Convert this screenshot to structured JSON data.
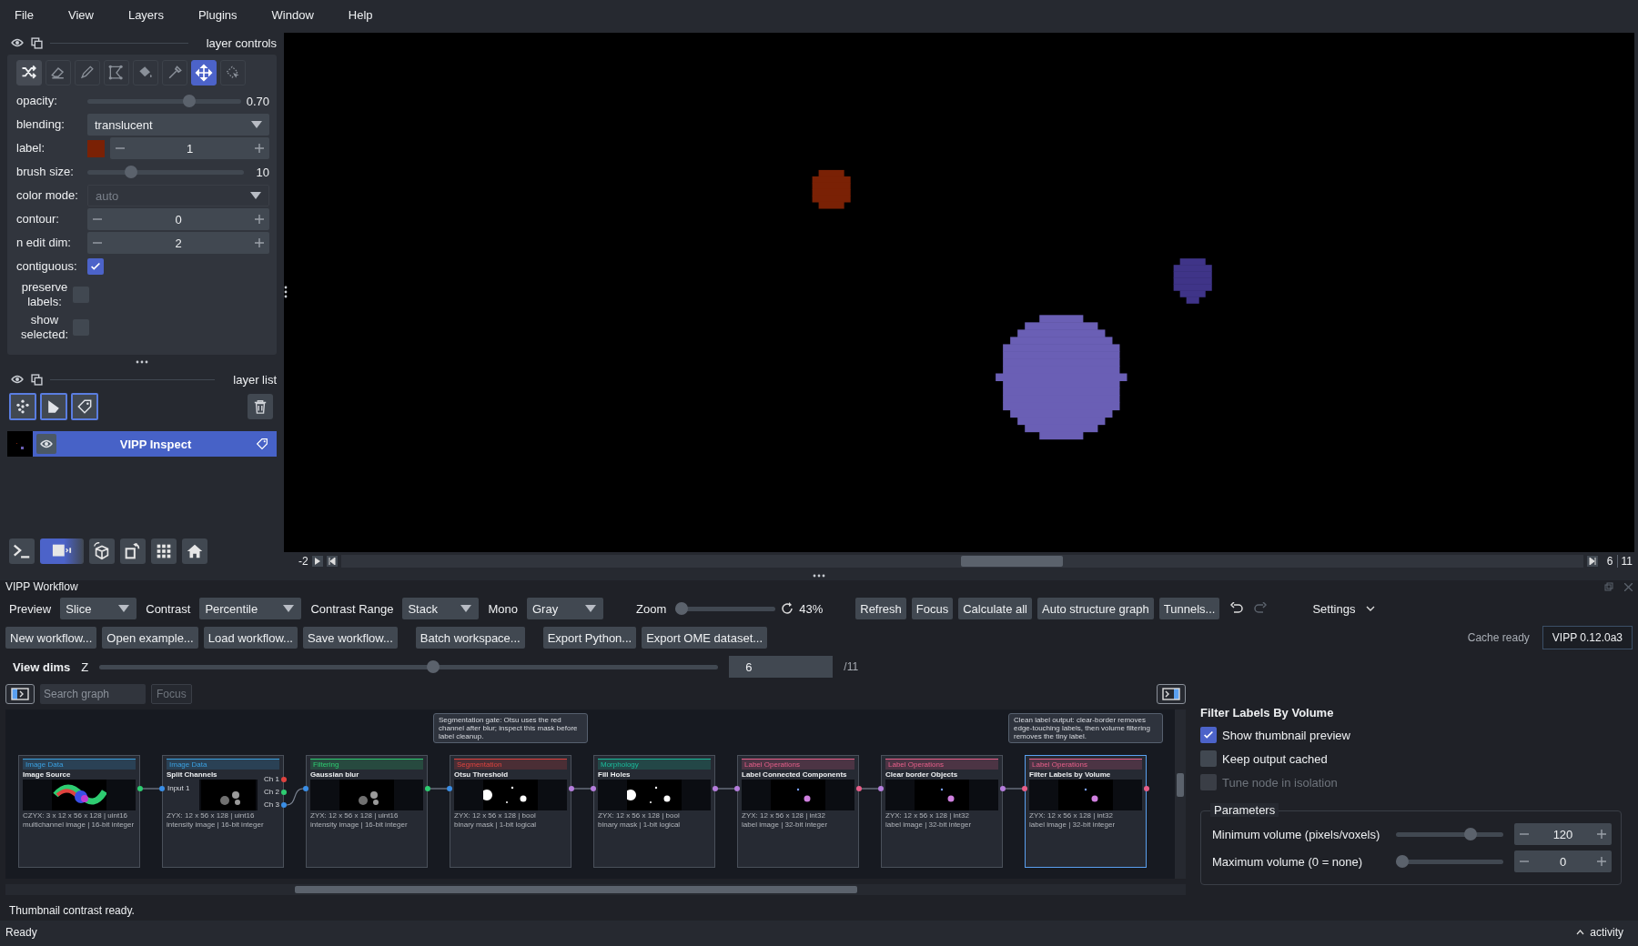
{
  "menu": [
    "File",
    "View",
    "Layers",
    "Plugins",
    "Window",
    "Help"
  ],
  "layer_controls": {
    "title": "layer controls",
    "tools": [
      {
        "kind": "shuffle",
        "selected": false
      },
      {
        "kind": "eraser",
        "selected": false
      },
      {
        "kind": "pencil",
        "selected": false
      },
      {
        "kind": "polygon",
        "selected": false
      },
      {
        "kind": "fill",
        "selected": false
      },
      {
        "kind": "picker",
        "selected": false
      },
      {
        "kind": "move",
        "selected": true
      },
      {
        "kind": "select",
        "selected": false
      }
    ],
    "rows": [
      {
        "kind": "slider",
        "label": "opacity:",
        "level": 0.68,
        "reading": "0.70"
      },
      {
        "kind": "dropdown",
        "label": "blending:",
        "value": "translucent",
        "disabled": false
      },
      {
        "kind": "label_spin",
        "label": "label:",
        "color": "#7a2105",
        "value": "1"
      },
      {
        "kind": "slider",
        "label": "brush size:",
        "level": 0.26,
        "reading": "10"
      },
      {
        "kind": "dropdown",
        "label": "color mode:",
        "value": "auto",
        "disabled": true
      },
      {
        "kind": "spin",
        "label": "contour:",
        "value": "0"
      },
      {
        "kind": "spin",
        "label": "n edit dim:",
        "value": "2"
      },
      {
        "kind": "checkbox",
        "label": "contiguous:",
        "checked": true
      },
      {
        "kind": "checkbox",
        "label": "preserve labels:",
        "checked": false
      },
      {
        "kind": "checkbox",
        "label": "show selected:",
        "checked": false
      }
    ]
  },
  "layer_list": {
    "title": "layer list",
    "add_buttons": [
      {
        "kind": "points"
      },
      {
        "kind": "shapes"
      },
      {
        "kind": "labels"
      }
    ],
    "layers": [
      {
        "name": "VIPP Inspect",
        "selected": true,
        "visible": true
      }
    ]
  },
  "viewer_buttons": [
    {
      "kind": "console",
      "selected": false
    },
    {
      "kind": "ndisplay",
      "selected": true
    },
    {
      "kind": "roll",
      "selected": false
    },
    {
      "kind": "transpose",
      "selected": false
    },
    {
      "kind": "grid",
      "selected": false
    },
    {
      "kind": "home",
      "selected": false
    }
  ],
  "dims": {
    "fps": "-2",
    "level": 0.54,
    "current": "6",
    "total": "11"
  },
  "workflow": {
    "title": "VIPP Workflow",
    "selectors": [
      {
        "label": "Preview",
        "value": "Slice"
      },
      {
        "label": "Contrast",
        "value": "Percentile"
      },
      {
        "label": "Contrast Range",
        "value": "Stack"
      },
      {
        "label": "Mono",
        "value": "Gray"
      }
    ],
    "zoom": {
      "label": "Zoom",
      "level": 0.0,
      "reading": "43%"
    },
    "actions": [
      {
        "label": "Refresh"
      },
      {
        "label": "Focus"
      },
      {
        "label": "Calculate all"
      },
      {
        "label": "Auto structure graph"
      },
      {
        "label": "Tunnels..."
      }
    ],
    "undo_enabled": true,
    "redo_enabled": false,
    "settings": "Settings",
    "file_buttons": [
      {
        "label": "New workflow..."
      },
      {
        "label": "Open example..."
      },
      {
        "label": "Load workflow..."
      },
      {
        "label": "Save workflow..."
      },
      {
        "label": "Batch workspace..."
      },
      {
        "label": "Export Python..."
      },
      {
        "label": "Export OME dataset..."
      }
    ],
    "cache_status": "Cache ready",
    "version": "VIPP 0.12.0a3",
    "view_dims": {
      "title": "View dims",
      "axis": "Z",
      "level": 0.54,
      "value": "6",
      "total": "/11"
    },
    "search": {
      "placeholder": "Search graph",
      "focus": "Focus",
      "sidebar_open": true,
      "inspector_open": true
    },
    "nodes": [
      {
        "category": "Image Data",
        "color": "#3aa0e0",
        "title": "Image Source",
        "meta": "CZYX: 3 x 12 x 56 x 128 | uint16",
        "type": "multichannel image | 16-bit integer",
        "outputs": [
          {
            "color": "#2ecc71"
          }
        ],
        "selected": false
      },
      {
        "category": "Image Data",
        "color": "#3aa0e0",
        "title": "Split Channels",
        "meta": "ZYX: 12 x 56 x 128 | uint16",
        "type": "intensity image | 16-bit integer",
        "inputs": [
          {
            "label": "Input 1",
            "color": "#3a8ee6"
          }
        ],
        "outputs": [
          {
            "label": "Ch 1",
            "color": "#e0433f"
          },
          {
            "label": "Ch 2",
            "color": "#2ecc71"
          },
          {
            "label": "Ch 3",
            "color": "#3a8ee6"
          }
        ],
        "selected": false
      },
      {
        "category": "Filtering",
        "color": "#2ecc71",
        "title": "Gaussian blur",
        "meta": "ZYX: 12 x 56 x 128 | uint16",
        "type": "intensity image | 16-bit integer",
        "inputs": [
          {
            "color": "#3a8ee6"
          }
        ],
        "outputs": [
          {
            "color": "#2ecc71"
          }
        ],
        "selected": false
      },
      {
        "category": "Segmentation",
        "color": "#e0433f",
        "title": "Otsu Threshold",
        "meta": "ZYX: 12 x 56 x 128 | bool",
        "type": "binary mask | 1-bit logical",
        "note": "Segmentation gate: Otsu uses the red channel after blur; inspect this mask before label cleanup.",
        "inputs": [
          {
            "color": "#3a8ee6"
          }
        ],
        "outputs": [
          {
            "color": "#b57edc"
          }
        ],
        "selected": false
      },
      {
        "category": "Morphology",
        "color": "#1abc9c",
        "title": "Fill Holes",
        "meta": "ZYX: 12 x 56 x 128 | bool",
        "type": "binary mask | 1-bit logical",
        "inputs": [
          {
            "color": "#b57edc"
          }
        ],
        "outputs": [
          {
            "color": "#b57edc"
          }
        ],
        "selected": false
      },
      {
        "category": "Label Operations",
        "color": "#e85f8a",
        "title": "Label Connected Components",
        "meta": "ZYX: 12 x 56 x 128 | int32",
        "type": "label image | 32-bit integer",
        "inputs": [
          {
            "color": "#b57edc"
          }
        ],
        "outputs": [
          {
            "color": "#e85f8a"
          }
        ],
        "selected": false
      },
      {
        "category": "Label Operations",
        "color": "#e85f8a",
        "title": "Clear border Objects",
        "meta": "ZYX: 12 x 56 x 128 | int32",
        "type": "label image | 32-bit integer",
        "inputs": [
          {
            "color": "#b57edc"
          }
        ],
        "outputs": [
          {
            "color": "#b57edc"
          }
        ],
        "selected": false
      },
      {
        "category": "Label Operations",
        "color": "#e85f8a",
        "title": "Filter Labels by Volume",
        "meta": "ZYX: 12 x 56 x 128 | int32",
        "type": "label image | 32-bit integer",
        "note": "Clean label output: clear-border removes edge-touching labels, then volume filtering removes the tiny label.",
        "inputs": [
          {
            "color": "#e85f8a"
          }
        ],
        "outputs": [
          {
            "color": "#e85f8a"
          }
        ],
        "selected": true
      }
    ],
    "inspector": {
      "title": "Filter Labels By Volume",
      "options": [
        {
          "label": "Show thumbnail preview",
          "checked": true,
          "disabled": false
        },
        {
          "label": "Keep output cached",
          "checked": false,
          "disabled": false
        },
        {
          "label": "Tune node in isolation",
          "checked": false,
          "disabled": true
        }
      ],
      "group": "Parameters",
      "params": [
        {
          "label": "Minimum volume (pixels/voxels)",
          "level": 0.72,
          "value": "120"
        },
        {
          "label": "Maximum volume (0 = none)",
          "level": 0.0,
          "value": "0"
        }
      ]
    },
    "message": "Thumbnail contrast ready."
  },
  "status_bar": {
    "text": "Ready",
    "activity": "activity"
  }
}
